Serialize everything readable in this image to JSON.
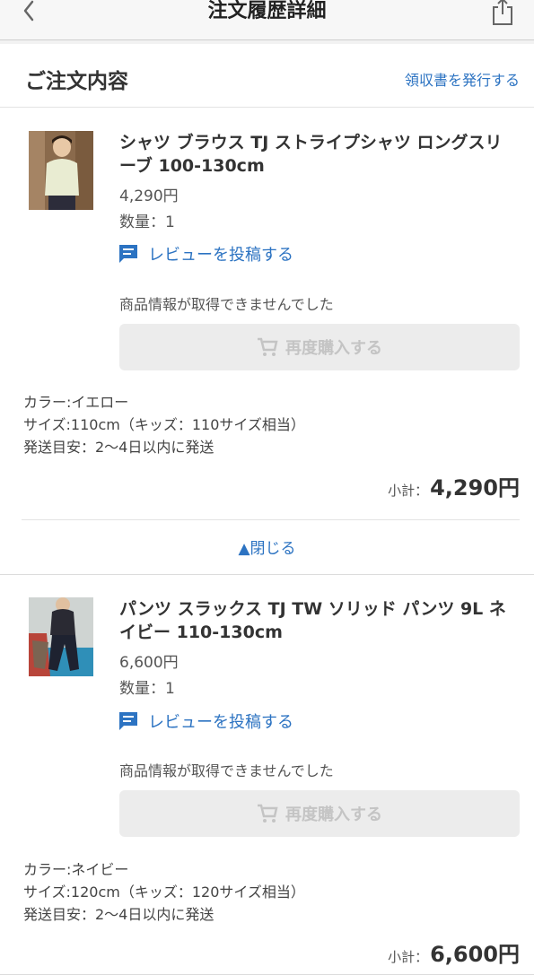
{
  "header": {
    "title": "注文履歴詳細"
  },
  "section": {
    "title": "ご注文内容",
    "receipt_link": "領収書を発行する"
  },
  "items": [
    {
      "name": "シャツ ブラウス TJ ストライプシャツ ロングスリーブ 100-130cm",
      "price": "4,290円",
      "quantity": "数量：1",
      "review_label": "レビューを投稿する",
      "no_info": "商品情報が取得できませんでした",
      "rebuy_label": "再度購入する",
      "color": "カラー:イエロー",
      "size": "サイズ:110cm（キッズ：110サイズ相当）",
      "shipping": "発送目安：2〜4日以内に発送",
      "subtotal_label": "小計：",
      "subtotal_value": "4,290円",
      "close_label": "▲閉じる"
    },
    {
      "name": "パンツ スラックス TJ TW ソリッド パンツ 9L ネイビー 110-130cm",
      "price": "6,600円",
      "quantity": "数量：1",
      "review_label": "レビューを投稿する",
      "no_info": "商品情報が取得できませんでした",
      "rebuy_label": "再度購入する",
      "color": "カラー:ネイビー",
      "size": "サイズ:120cm（キッズ：120サイズ相当）",
      "shipping": "発送目安：2〜4日以内に発送",
      "subtotal_label": "小計：",
      "subtotal_value": "6,600円"
    }
  ],
  "colors": {
    "link": "#2c73c2",
    "disabled": "#c4c4c4"
  },
  "icons": [
    "back-chevron-icon",
    "share-icon",
    "review-icon",
    "cart-icon"
  ]
}
